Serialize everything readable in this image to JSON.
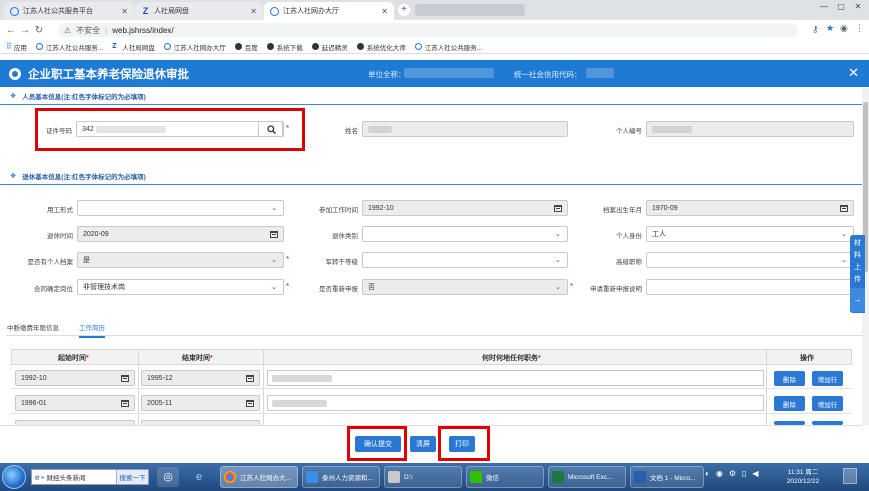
{
  "browser": {
    "tabs": [
      {
        "title": "江苏人社公共服务平台",
        "icon": "globe-icon"
      },
      {
        "title": "人社局网盘",
        "icon": "z-icon"
      },
      {
        "title": "江苏人社网办大厅",
        "icon": "globe-icon"
      }
    ],
    "address": {
      "security": "不安全",
      "url": "web.jshrss/index/"
    },
    "bookmarks": [
      "应用",
      "江苏人社公共服务...",
      "人社局网盘",
      "江苏人社网办大厅",
      "百度",
      "系统下载",
      "延迟精灵",
      "系统优化大师",
      "江苏人社公共服务..."
    ]
  },
  "app": {
    "title": "企业职工基本养老保险退休审批",
    "unit_label": "单位全称：",
    "credit_label": "统一社会信用代码："
  },
  "section1": {
    "title": "人员基本信息(注:红色字体标记的为必填项)",
    "id_label": "证件号码",
    "id_value": "342",
    "name_label": "姓名",
    "pid_label": "个人编号"
  },
  "section2": {
    "title": "退休基本信息(注:红色字体标记的为必填项)",
    "employment_label": "用工形式",
    "work_start_label": "参加工作时间",
    "work_start_value": "1992-10",
    "archive_birth_label": "档案出生年月",
    "archive_birth_value": "1970-09",
    "retire_time_label": "退休时间",
    "retire_time_value": "2020-09",
    "retire_type_label": "退休类别",
    "identity_label": "个人身份",
    "identity_value": "工人",
    "personal_archive_label": "是否有个人档案",
    "personal_archive_value": "是",
    "cadre_level_label": "军转干等级",
    "title_label": "高级职称",
    "contract_label": "合同确定岗位",
    "contract_value": "非管理技术岗",
    "redeclare_label": "是否重新申报",
    "redeclare_value": "否",
    "redeclare_note_label": "申请重新申报说明"
  },
  "subtabs": [
    "中断缴费年限信息",
    "工作简历"
  ],
  "resume_table": {
    "headers": [
      "起始时间",
      "结束时间",
      "何时何地任何职务",
      "操作"
    ],
    "rows": [
      {
        "start": "1992-10",
        "end": "1995-12"
      },
      {
        "start": "1996-01",
        "end": "2005-11"
      }
    ],
    "delete_label": "删除",
    "add_label": "增加行"
  },
  "side_tab": [
    "材",
    "料",
    "上",
    "传"
  ],
  "actions": {
    "submit": "确认提交",
    "clear": "清屏",
    "print": "打印"
  },
  "taskbar": {
    "search_text": "财经头条新闻",
    "search_go": "搜索一下",
    "items": [
      "江苏人社网办大...",
      "泰州人力资源和...",
      "D:\\",
      "微信",
      "Microsoft Exc...",
      "文档 1 - Micro..."
    ],
    "time": "11:31 周二",
    "date": "2020/12/22"
  },
  "colors": {
    "header": "#1f7ad3",
    "button": "#2a78d3",
    "highlight": "#e00000"
  }
}
